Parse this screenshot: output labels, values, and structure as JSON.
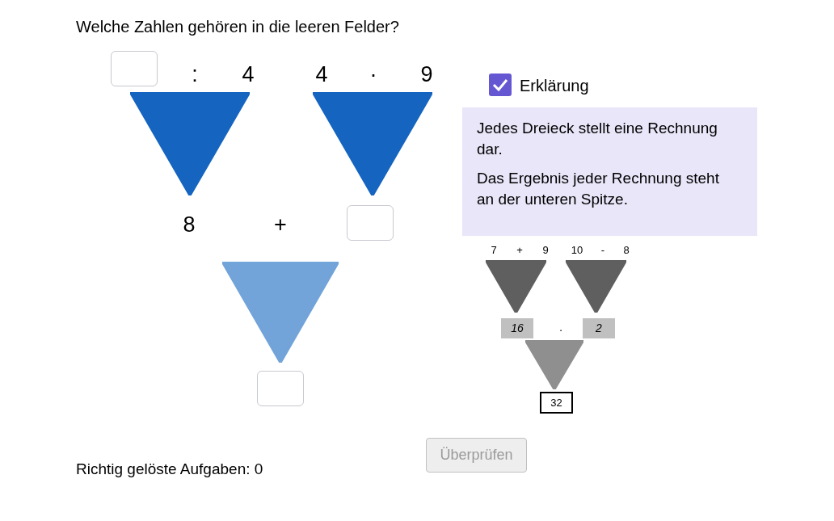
{
  "question": "Welche Zahlen gehören in die leeren Felder?",
  "puzzle": {
    "top_row": [
      {
        "kind": "field"
      },
      {
        "kind": "text",
        "text": ":"
      },
      {
        "kind": "text",
        "text": "4"
      },
      {
        "kind": "text",
        "text": "4"
      },
      {
        "kind": "text",
        "text": "·"
      },
      {
        "kind": "text",
        "text": "9"
      }
    ],
    "middle_row": [
      {
        "kind": "text",
        "text": "8"
      },
      {
        "kind": "text",
        "text": "+"
      },
      {
        "kind": "field"
      }
    ],
    "result": {
      "kind": "field"
    },
    "triangles": [
      {
        "color": "#1565c0"
      },
      {
        "color": "#1565c0"
      },
      {
        "color": "#72a3d9"
      }
    ]
  },
  "explanation": {
    "checkbox": {
      "label": "Erklärung",
      "checked": true
    },
    "paragraphs": [
      "Jedes Dreieck stellt eine Rechnung dar.",
      "Das Ergebnis jeder Rechnung steht an der unteren Spitze."
    ],
    "example": {
      "top_row": [
        "7",
        "+",
        "9",
        "10",
        "-",
        "8"
      ],
      "middle_row": [
        "16",
        "·",
        "2"
      ],
      "result": "32"
    }
  },
  "score": "Richtig gelöste Aufgaben: 0",
  "check_button": {
    "label": "Überprüfen",
    "disabled": true
  }
}
